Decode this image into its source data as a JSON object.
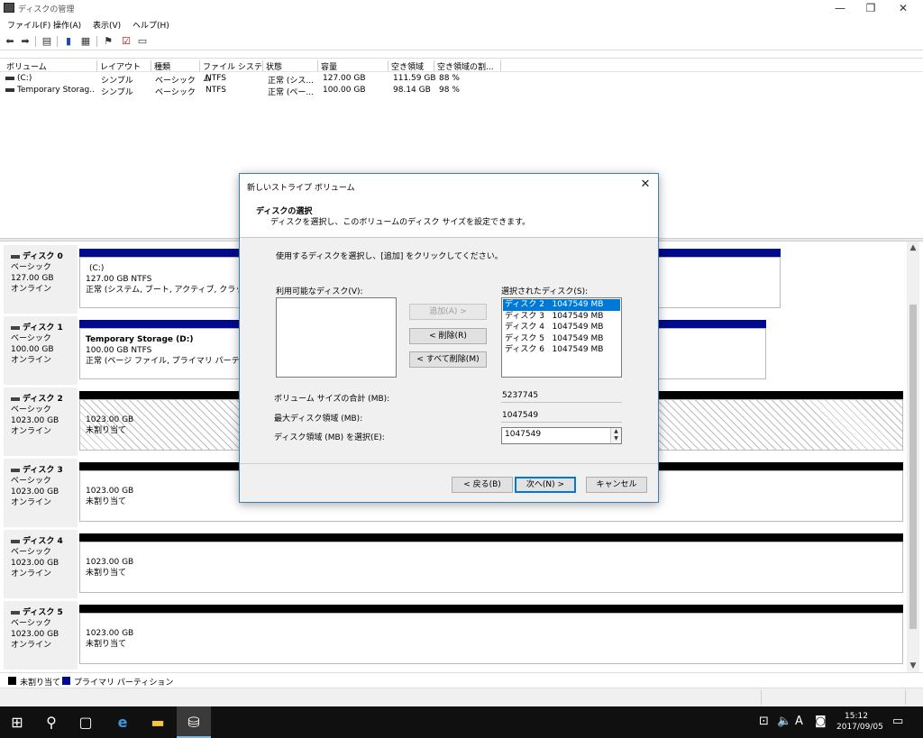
{
  "window": {
    "title": "ディスクの管理",
    "controls": [
      "—",
      "❐",
      "✕"
    ]
  },
  "menu": [
    "ファイル(F)",
    "操作(A)",
    "表示(V)",
    "ヘルプ(H)"
  ],
  "volume_list": {
    "headers": [
      "ボリューム",
      "レイアウト",
      "種類",
      "ファイル システム",
      "状態",
      "容量",
      "空き領域",
      "空き領域の割..."
    ],
    "rows": [
      [
        "(C:)",
        "シンプル",
        "ベーシック",
        "NTFS",
        "正常 (シス...",
        "127.00 GB",
        "111.59 GB",
        "88 %"
      ],
      [
        "Temporary Storag...",
        "シンプル",
        "ベーシック",
        "NTFS",
        "正常 (ペー...",
        "100.00 GB",
        "98.14 GB",
        "98 %"
      ]
    ]
  },
  "disks": [
    {
      "name": "ディスク 0",
      "type": "ベーシック",
      "size": "127.00 GB",
      "status": "オンライン",
      "partition": {
        "title": "(C:)",
        "detail": "127.00 GB NTFS",
        "state": "正常 (システム, ブート, アクティブ, クラッシュ ダン"
      }
    },
    {
      "name": "ディスク 1",
      "type": "ベーシック",
      "size": "100.00 GB",
      "status": "オンライン",
      "partition": {
        "title": "Temporary Storage  (D:)",
        "detail": "100.00 GB NTFS",
        "state": "正常 (ページ ファイル, プライマリ パーティション)"
      }
    },
    {
      "name": "ディスク 2",
      "type": "ベーシック",
      "size": "1023.00 GB",
      "status": "オンライン",
      "partition": {
        "detail": "1023.00 GB",
        "state": "未割り当て"
      }
    },
    {
      "name": "ディスク 3",
      "type": "ベーシック",
      "size": "1023.00 GB",
      "status": "オンライン",
      "partition": {
        "detail": "1023.00 GB",
        "state": "未割り当て"
      }
    },
    {
      "name": "ディスク 4",
      "type": "ベーシック",
      "size": "1023.00 GB",
      "status": "オンライン",
      "partition": {
        "detail": "1023.00 GB",
        "state": "未割り当て"
      }
    },
    {
      "name": "ディスク 5",
      "type": "ベーシック",
      "size": "1023.00 GB",
      "status": "オンライン",
      "partition": {
        "detail": "1023.00 GB",
        "state": "未割り当て"
      }
    }
  ],
  "legend": {
    "unallocated": "未割り当て",
    "primary": "プライマリ パーティション",
    "unallocated_color": "#000000",
    "primary_color": "#000a8c"
  },
  "dialog": {
    "title": "新しいストライプ ボリューム",
    "heading": "ディスクの選択",
    "subheading": "ディスクを選択し、このボリュームのディスク サイズを設定できます。",
    "instruction": "使用するディスクを選択し、[追加] をクリックしてください。",
    "available_label": "利用可能なディスク(V):",
    "selected_label": "選択されたディスク(S):",
    "selected_disks": [
      "ディスク 2   1047549 MB",
      "ディスク 3   1047549 MB",
      "ディスク 4   1047549 MB",
      "ディスク 5   1047549 MB",
      "ディスク 6   1047549 MB"
    ],
    "add_button": "追加(A) >",
    "remove_button": "< 削除(R)",
    "remove_all_button": "< すべて削除(M)",
    "total_size_label": "ボリューム サイズの合計 (MB):",
    "total_size_value": "5237745",
    "max_space_label": "最大ディスク領域 (MB):",
    "max_space_value": "1047549",
    "select_space_label": "ディスク領域 (MB) を選択(E):",
    "select_space_value": "1047549",
    "back_button": "< 戻る(B)",
    "next_button": "次へ(N) >",
    "cancel_button": "キャンセル"
  },
  "taskbar": {
    "time": "15:12",
    "date": "2017/09/05",
    "ime": "A"
  }
}
